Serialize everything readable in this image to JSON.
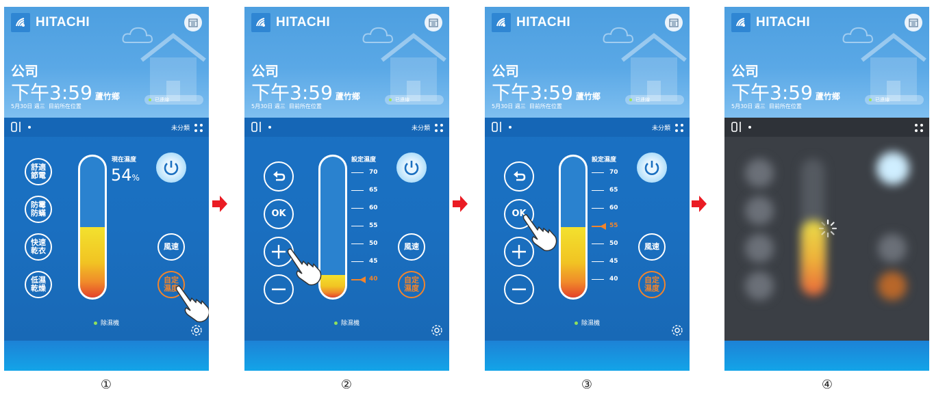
{
  "header": {
    "brand": "HITACHI",
    "location": "公司",
    "time": "下午3:59",
    "city": "蘆竹鄉",
    "date": "5月30日 週三",
    "current_position": "目前所在位置",
    "connection_status": "已連線"
  },
  "toolbar": {
    "category": "未分類"
  },
  "modes": {
    "comfort": "舒適節電",
    "mold": "防霉防蟎",
    "dry": "快速乾衣",
    "low": "低濕乾燥",
    "fan": "風速",
    "custom": "自定濕度"
  },
  "controls": {
    "back": "back",
    "ok": "OK"
  },
  "humidity": {
    "current_label": "現在濕度",
    "current_value": "54",
    "unit": "%",
    "set_label": "設定濕度",
    "scale": [
      "70",
      "65",
      "60",
      "55",
      "50",
      "45",
      "40"
    ],
    "step2_selected": "40",
    "step3_selected": "55"
  },
  "levels": {
    "panel1": 0.5,
    "panel2": 0.16,
    "panel3": 0.5,
    "panel4": 0.5
  },
  "device": {
    "name": "除濕機"
  },
  "steps": [
    "①",
    "②",
    "③",
    "④"
  ],
  "colors": {
    "accent": "#f2842b",
    "panel_blue": "#1a6fc0",
    "arrow_red": "#ea1c24"
  },
  "icons": [
    "wifi-icon",
    "calendar-icon",
    "cloud-icon",
    "house-icon",
    "device-icon",
    "grid-icon",
    "power-icon",
    "back-icon",
    "plus-icon",
    "minus-icon",
    "gear-icon",
    "hand-pointer-icon",
    "loading-spinner-icon",
    "arrow-right-icon"
  ]
}
